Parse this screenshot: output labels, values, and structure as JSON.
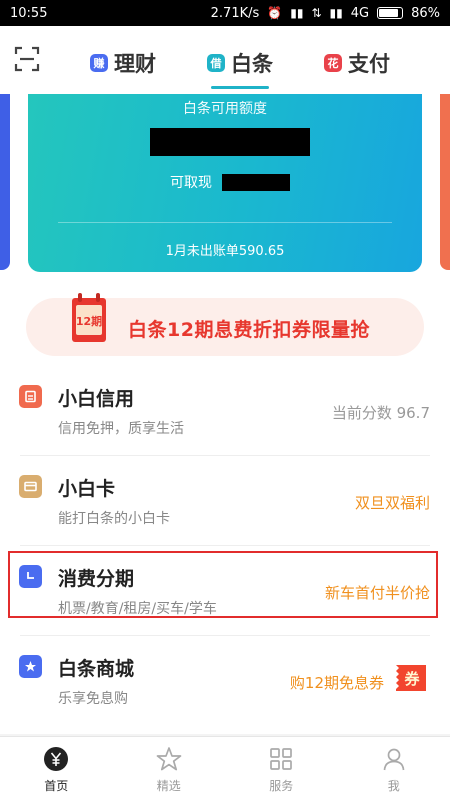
{
  "status_bar": {
    "time": "10:55",
    "net_speed": "2.71K/s",
    "network": "4G",
    "battery": "86%",
    "battery_level": 0.86
  },
  "top_tabs": [
    {
      "badge": "赚",
      "label": "理财",
      "color": "#4a6cf0",
      "active": false
    },
    {
      "badge": "借",
      "label": "白条",
      "color": "#1fb3c8",
      "active": true
    },
    {
      "badge": "花",
      "label": "支付",
      "color": "#e9424a",
      "active": false
    }
  ],
  "credit_card": {
    "title": "白条可用额度",
    "withdraw_label": "可取现",
    "bill_text": "1月未出账单590.65"
  },
  "promo": {
    "icon_text": "12期",
    "text": "白条12期息费折扣券限量抢"
  },
  "list_items": [
    {
      "title": "小白信用",
      "subtitle": "信用免押，质享生活",
      "right": "当前分数 96.7",
      "icon": "credit-icon",
      "icon_color": "#f06a4e",
      "right_color": "#999999"
    },
    {
      "title": "小白卡",
      "subtitle": "能打白条的小白卡",
      "right": "双旦双福利",
      "icon": "card-icon",
      "icon_color": "#d9ad6f",
      "right_color": "#f0901e"
    },
    {
      "title": "消费分期",
      "subtitle": "机票/教育/租房/买车/学车",
      "right": "新车首付半价抢",
      "icon": "clock-icon",
      "icon_color": "#4a6cf0",
      "right_color": "#f0901e"
    },
    {
      "title": "白条商城",
      "subtitle": "乐享免息购",
      "right": "购12期免息券",
      "icon": "star-icon",
      "icon_color": "#4a6cf0",
      "right_color": "#f0901e",
      "badge": "券"
    }
  ],
  "bottom_nav": [
    {
      "label": "首页",
      "icon": "home-yen-icon",
      "active": true
    },
    {
      "label": "精选",
      "icon": "star-outline-icon",
      "active": false
    },
    {
      "label": "服务",
      "icon": "grid-icon",
      "active": false
    },
    {
      "label": "我",
      "icon": "user-icon",
      "active": false
    }
  ]
}
